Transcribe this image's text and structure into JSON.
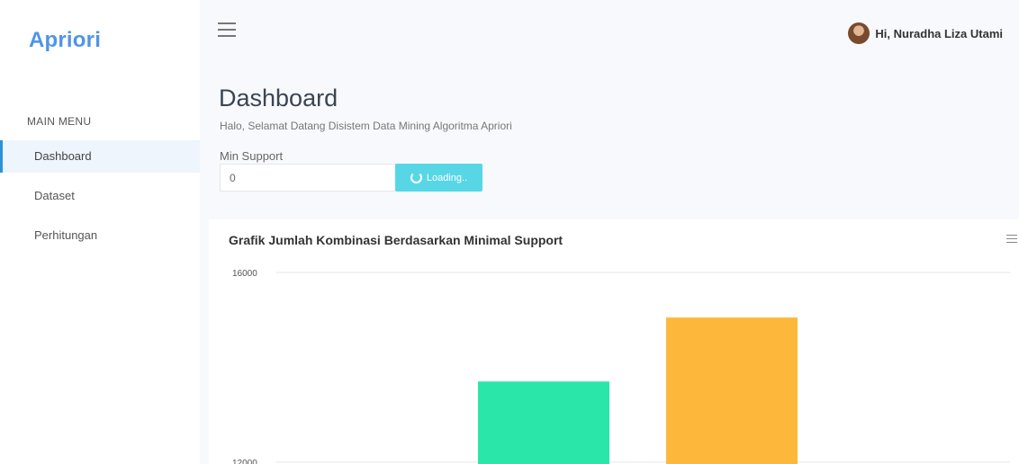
{
  "sidebar": {
    "brand": "Apriori",
    "menu_title": "MAIN MENU",
    "items": [
      {
        "label": "Dashboard"
      },
      {
        "label": "Dataset"
      },
      {
        "label": "Perhitungan"
      }
    ]
  },
  "topbar": {
    "user_greeting": "Hi, Nuradha Liza Utami"
  },
  "page": {
    "title": "Dashboard",
    "subtitle": "Halo, Selamat Datang Disistem Data Mining Algoritma Apriori",
    "min_support_label": "Min Support",
    "min_support_value": "0",
    "button_label": "Loading.."
  },
  "chart_data": {
    "type": "bar",
    "title": "Grafik Jumlah Kombinasi Berdasarkan Minimal Support",
    "ytick_labels": [
      "16000",
      "12000"
    ],
    "ylim": [
      9000,
      16000
    ],
    "values": [
      13700,
      15050
    ],
    "colors": [
      "#2ae6a9",
      "#fdb83b"
    ]
  }
}
